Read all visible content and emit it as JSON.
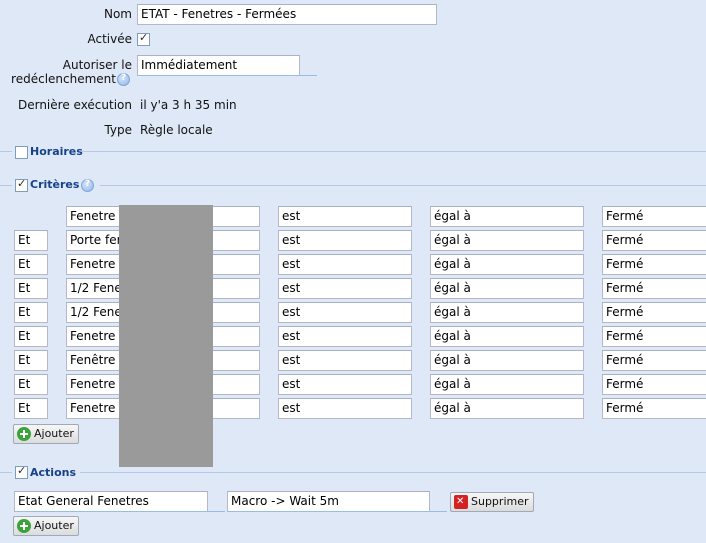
{
  "form": {
    "name_label": "Nom",
    "name_value": "ETAT - Fenetres - Fermées",
    "active_label": "Activée",
    "retrigger_label_line1": "Autoriser le",
    "retrigger_label_line2": "redéclenchement",
    "retrigger_value": "Immédiatement",
    "last_exec_label": "Dernière exécution",
    "last_exec_value": "il y'a 3 h 35 min",
    "type_label": "Type",
    "type_value": "Règle locale"
  },
  "sections": {
    "horaires": "Horaires",
    "criteres": "Critères",
    "actions": "Actions"
  },
  "criteria": [
    {
      "join": "",
      "device": "Fenetre",
      "op": "est",
      "cmp": "égal à",
      "value": "Fermé"
    },
    {
      "join": "Et",
      "device": "Porte fer",
      "op": "est",
      "cmp": "égal à",
      "value": "Fermé"
    },
    {
      "join": "Et",
      "device": "Fenetre",
      "op": "est",
      "cmp": "égal à",
      "value": "Fermé"
    },
    {
      "join": "Et",
      "device": "1/2 Fene",
      "op": "est",
      "cmp": "égal à",
      "value": "Fermé"
    },
    {
      "join": "Et",
      "device": "1/2 Fene",
      "op": "est",
      "cmp": "égal à",
      "value": "Fermé"
    },
    {
      "join": "Et",
      "device": "Fenetre",
      "op": "est",
      "cmp": "égal à",
      "value": "Fermé"
    },
    {
      "join": "Et",
      "device": "Fenêtre",
      "op": "est",
      "cmp": "égal à",
      "value": "Fermé"
    },
    {
      "join": "Et",
      "device": "Fenetre",
      "op": "est",
      "cmp": "égal à",
      "value": "Fermé"
    },
    {
      "join": "Et",
      "device": "Fenetre",
      "op": "est",
      "cmp": "égal à",
      "value": "Fermé"
    }
  ],
  "buttons": {
    "add_criteria": "Ajouter",
    "add_action": "Ajouter",
    "delete_action": "Supprimer"
  },
  "actions": [
    {
      "target": "Etat General Fenetres",
      "command": "Macro -> Wait 5m"
    }
  ]
}
